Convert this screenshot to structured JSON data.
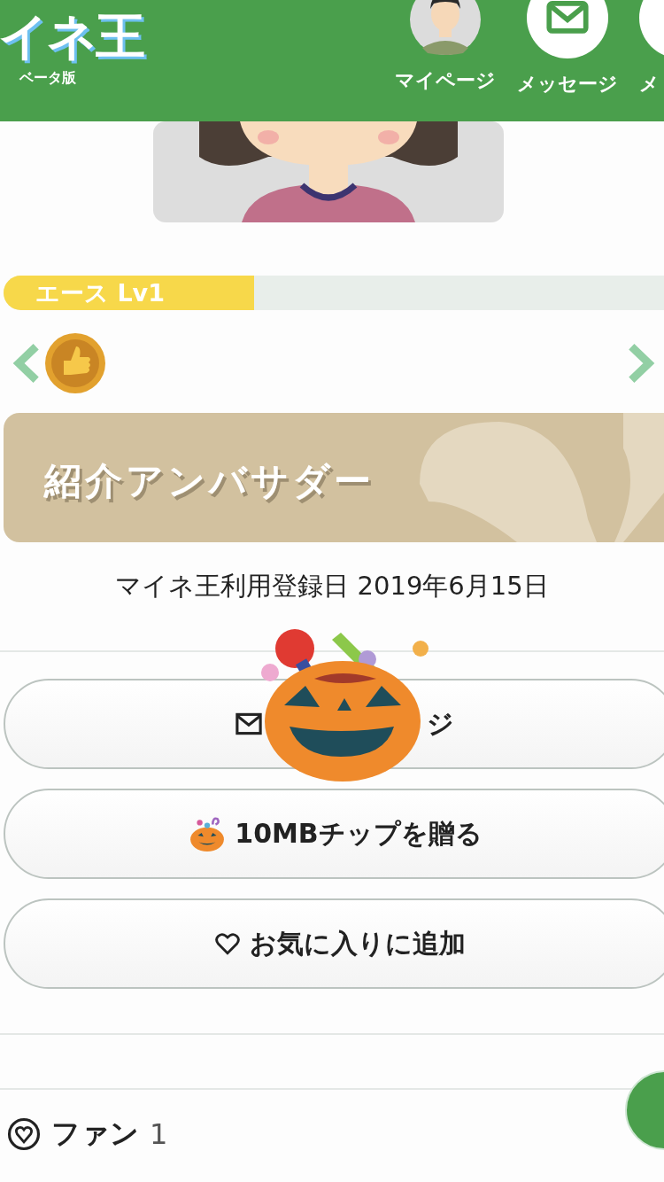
{
  "header": {
    "logo": "イネ王",
    "logo_sub": "ベータ版",
    "nav": [
      {
        "label": "マイページ",
        "kind": "avatar"
      },
      {
        "label": "メッセージ",
        "kind": "mail"
      },
      {
        "label": "メ",
        "kind": "plain"
      }
    ]
  },
  "rank": {
    "label": "エース Lv1",
    "level": 0.38
  },
  "badge_title": "紹介アンバサダー",
  "registered": "マイネ王利用登録日 2019年6月15日",
  "buttons": [
    {
      "label": "ジ",
      "kind": "message"
    },
    {
      "label": "10MBチップを贈る",
      "kind": "tip"
    },
    {
      "label": "お気に入りに追加",
      "kind": "favorite"
    }
  ],
  "fans": {
    "label": "ファン",
    "count": "1"
  }
}
